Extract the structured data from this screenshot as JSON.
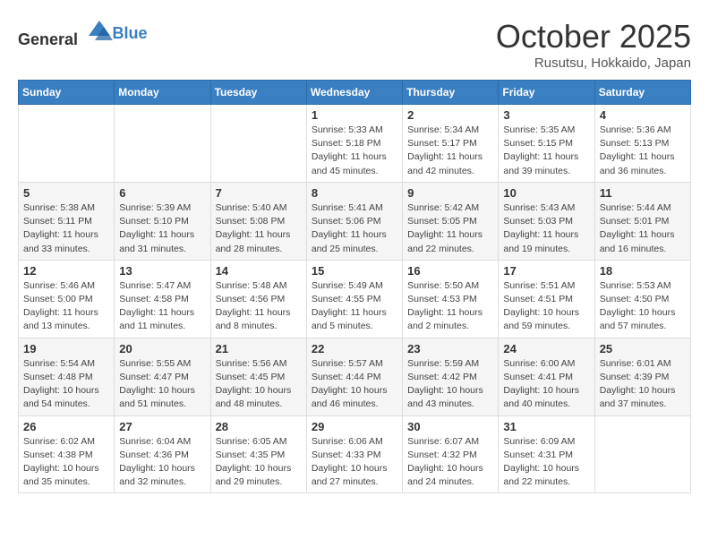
{
  "header": {
    "logo_general": "General",
    "logo_blue": "Blue",
    "title": "October 2025",
    "subtitle": "Rusutsu, Hokkaido, Japan"
  },
  "weekdays": [
    "Sunday",
    "Monday",
    "Tuesday",
    "Wednesday",
    "Thursday",
    "Friday",
    "Saturday"
  ],
  "weeks": [
    [
      {
        "day": "",
        "info": ""
      },
      {
        "day": "",
        "info": ""
      },
      {
        "day": "",
        "info": ""
      },
      {
        "day": "1",
        "info": "Sunrise: 5:33 AM\nSunset: 5:18 PM\nDaylight: 11 hours and 45 minutes."
      },
      {
        "day": "2",
        "info": "Sunrise: 5:34 AM\nSunset: 5:17 PM\nDaylight: 11 hours and 42 minutes."
      },
      {
        "day": "3",
        "info": "Sunrise: 5:35 AM\nSunset: 5:15 PM\nDaylight: 11 hours and 39 minutes."
      },
      {
        "day": "4",
        "info": "Sunrise: 5:36 AM\nSunset: 5:13 PM\nDaylight: 11 hours and 36 minutes."
      }
    ],
    [
      {
        "day": "5",
        "info": "Sunrise: 5:38 AM\nSunset: 5:11 PM\nDaylight: 11 hours and 33 minutes."
      },
      {
        "day": "6",
        "info": "Sunrise: 5:39 AM\nSunset: 5:10 PM\nDaylight: 11 hours and 31 minutes."
      },
      {
        "day": "7",
        "info": "Sunrise: 5:40 AM\nSunset: 5:08 PM\nDaylight: 11 hours and 28 minutes."
      },
      {
        "day": "8",
        "info": "Sunrise: 5:41 AM\nSunset: 5:06 PM\nDaylight: 11 hours and 25 minutes."
      },
      {
        "day": "9",
        "info": "Sunrise: 5:42 AM\nSunset: 5:05 PM\nDaylight: 11 hours and 22 minutes."
      },
      {
        "day": "10",
        "info": "Sunrise: 5:43 AM\nSunset: 5:03 PM\nDaylight: 11 hours and 19 minutes."
      },
      {
        "day": "11",
        "info": "Sunrise: 5:44 AM\nSunset: 5:01 PM\nDaylight: 11 hours and 16 minutes."
      }
    ],
    [
      {
        "day": "12",
        "info": "Sunrise: 5:46 AM\nSunset: 5:00 PM\nDaylight: 11 hours and 13 minutes."
      },
      {
        "day": "13",
        "info": "Sunrise: 5:47 AM\nSunset: 4:58 PM\nDaylight: 11 hours and 11 minutes."
      },
      {
        "day": "14",
        "info": "Sunrise: 5:48 AM\nSunset: 4:56 PM\nDaylight: 11 hours and 8 minutes."
      },
      {
        "day": "15",
        "info": "Sunrise: 5:49 AM\nSunset: 4:55 PM\nDaylight: 11 hours and 5 minutes."
      },
      {
        "day": "16",
        "info": "Sunrise: 5:50 AM\nSunset: 4:53 PM\nDaylight: 11 hours and 2 minutes."
      },
      {
        "day": "17",
        "info": "Sunrise: 5:51 AM\nSunset: 4:51 PM\nDaylight: 10 hours and 59 minutes."
      },
      {
        "day": "18",
        "info": "Sunrise: 5:53 AM\nSunset: 4:50 PM\nDaylight: 10 hours and 57 minutes."
      }
    ],
    [
      {
        "day": "19",
        "info": "Sunrise: 5:54 AM\nSunset: 4:48 PM\nDaylight: 10 hours and 54 minutes."
      },
      {
        "day": "20",
        "info": "Sunrise: 5:55 AM\nSunset: 4:47 PM\nDaylight: 10 hours and 51 minutes."
      },
      {
        "day": "21",
        "info": "Sunrise: 5:56 AM\nSunset: 4:45 PM\nDaylight: 10 hours and 48 minutes."
      },
      {
        "day": "22",
        "info": "Sunrise: 5:57 AM\nSunset: 4:44 PM\nDaylight: 10 hours and 46 minutes."
      },
      {
        "day": "23",
        "info": "Sunrise: 5:59 AM\nSunset: 4:42 PM\nDaylight: 10 hours and 43 minutes."
      },
      {
        "day": "24",
        "info": "Sunrise: 6:00 AM\nSunset: 4:41 PM\nDaylight: 10 hours and 40 minutes."
      },
      {
        "day": "25",
        "info": "Sunrise: 6:01 AM\nSunset: 4:39 PM\nDaylight: 10 hours and 37 minutes."
      }
    ],
    [
      {
        "day": "26",
        "info": "Sunrise: 6:02 AM\nSunset: 4:38 PM\nDaylight: 10 hours and 35 minutes."
      },
      {
        "day": "27",
        "info": "Sunrise: 6:04 AM\nSunset: 4:36 PM\nDaylight: 10 hours and 32 minutes."
      },
      {
        "day": "28",
        "info": "Sunrise: 6:05 AM\nSunset: 4:35 PM\nDaylight: 10 hours and 29 minutes."
      },
      {
        "day": "29",
        "info": "Sunrise: 6:06 AM\nSunset: 4:33 PM\nDaylight: 10 hours and 27 minutes."
      },
      {
        "day": "30",
        "info": "Sunrise: 6:07 AM\nSunset: 4:32 PM\nDaylight: 10 hours and 24 minutes."
      },
      {
        "day": "31",
        "info": "Sunrise: 6:09 AM\nSunset: 4:31 PM\nDaylight: 10 hours and 22 minutes."
      },
      {
        "day": "",
        "info": ""
      }
    ]
  ]
}
